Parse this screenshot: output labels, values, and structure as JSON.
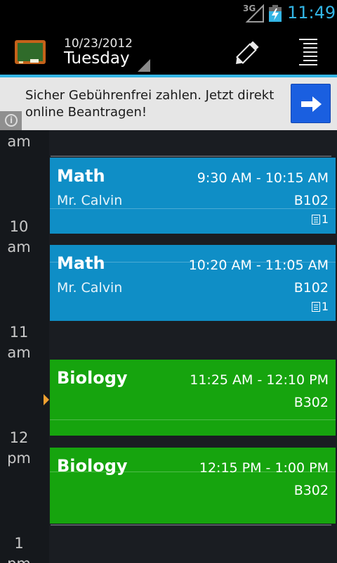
{
  "status_bar": {
    "network": "3G",
    "time": "11:49",
    "accent": "#33b5e5",
    "icons": [
      "signal-icon",
      "battery-charging-icon"
    ]
  },
  "action_bar": {
    "date": "10/23/2012",
    "day": "Tuesday",
    "icons": [
      "chalkboard-app-icon",
      "pencil-edit-icon",
      "list-view-icon"
    ]
  },
  "ad": {
    "text": "Sicher Gebührenfrei zahlen. Jetzt direkt online Beantragen!",
    "info_label": "i",
    "icons": [
      "info-icon",
      "arrow-right-icon"
    ]
  },
  "hours": [
    {
      "hour": "",
      "period": "am"
    },
    {
      "hour": "10",
      "period": "am"
    },
    {
      "hour": "11",
      "period": "am"
    },
    {
      "hour": "12",
      "period": "pm"
    },
    {
      "hour": "1",
      "period": "pm"
    }
  ],
  "events": [
    {
      "title": "Math",
      "time": "9:30 AM - 10:15 AM",
      "teacher": "Mr. Calvin",
      "room": "B102",
      "count": "1",
      "color": "#0f8ec6"
    },
    {
      "title": "Math",
      "time": "10:20 AM - 11:05 AM",
      "teacher": "Mr. Calvin",
      "room": "B102",
      "count": "1",
      "color": "#0f8ec6"
    },
    {
      "title": "Biology",
      "time": "11:25 AM - 12:10 PM",
      "teacher": "",
      "room": "B302",
      "count": "",
      "color": "#16a40e"
    },
    {
      "title": "Biology",
      "time": "12:15 PM - 1:00 PM",
      "teacher": "",
      "room": "B302",
      "count": "",
      "color": "#16a40e"
    }
  ]
}
